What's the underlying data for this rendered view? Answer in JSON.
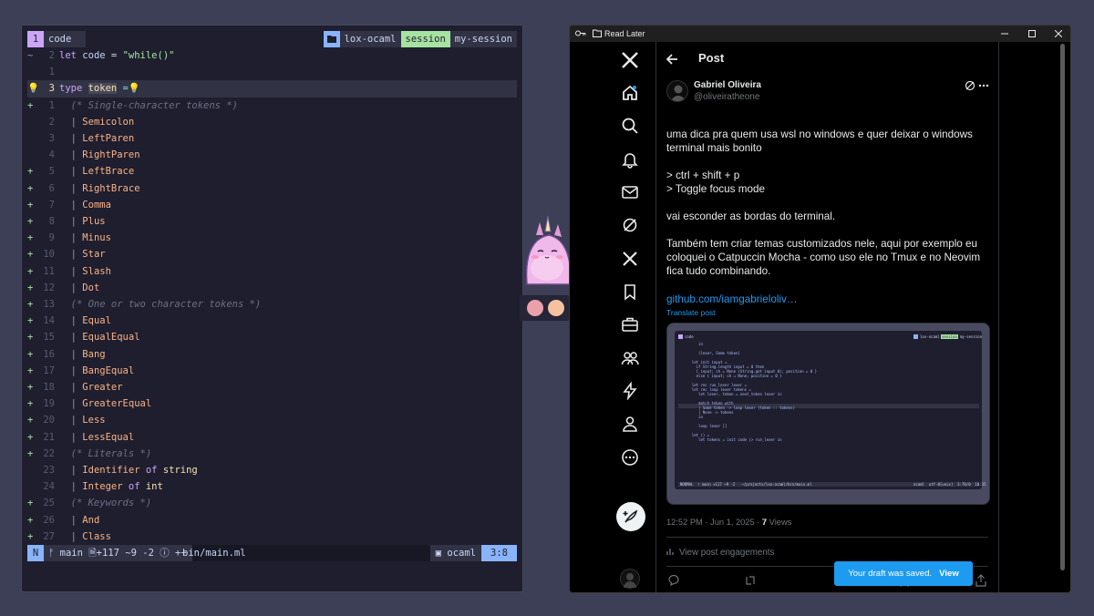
{
  "terminal": {
    "tmux": {
      "window_index": "1",
      "window_name": "code",
      "project": "lox-ocaml",
      "session_label": "session",
      "session_name": "my-session"
    },
    "lines": [
      {
        "sign": "~",
        "num": "2",
        "parts": [
          [
            "kw",
            "let "
          ],
          [
            "",
            "code = "
          ],
          [
            "str",
            "\"while()\""
          ]
        ]
      },
      {
        "sign": "",
        "num": "1",
        "parts": []
      },
      {
        "sign": "💡",
        "num": "3",
        "cur": true,
        "parts": [
          [
            "kw",
            "type "
          ],
          [
            "tok",
            "token"
          ],
          [
            "op",
            " ="
          ],
          [
            "",
            "💡"
          ]
        ]
      },
      {
        "sign": "+",
        "num": "1",
        "parts": [
          [
            "cm",
            "  (* Single-character tokens *)"
          ]
        ]
      },
      {
        "sign": "",
        "num": "2",
        "parts": [
          [
            "bar",
            "  | "
          ],
          [
            "ctor",
            "Semicolon"
          ]
        ]
      },
      {
        "sign": "",
        "num": "3",
        "parts": [
          [
            "bar",
            "  | "
          ],
          [
            "ctor",
            "LeftParen"
          ]
        ]
      },
      {
        "sign": "",
        "num": "4",
        "parts": [
          [
            "bar",
            "  | "
          ],
          [
            "ctor",
            "RightParen"
          ]
        ]
      },
      {
        "sign": "+",
        "num": "5",
        "parts": [
          [
            "bar",
            "  | "
          ],
          [
            "ctor",
            "LeftBrace"
          ]
        ]
      },
      {
        "sign": "+",
        "num": "6",
        "parts": [
          [
            "bar",
            "  | "
          ],
          [
            "ctor",
            "RightBrace"
          ]
        ]
      },
      {
        "sign": "+",
        "num": "7",
        "parts": [
          [
            "bar",
            "  | "
          ],
          [
            "ctor",
            "Comma"
          ]
        ]
      },
      {
        "sign": "+",
        "num": "8",
        "parts": [
          [
            "bar",
            "  | "
          ],
          [
            "ctor",
            "Plus"
          ]
        ]
      },
      {
        "sign": "+",
        "num": "9",
        "parts": [
          [
            "bar",
            "  | "
          ],
          [
            "ctor",
            "Minus"
          ]
        ]
      },
      {
        "sign": "+",
        "num": "10",
        "parts": [
          [
            "bar",
            "  | "
          ],
          [
            "ctor",
            "Star"
          ]
        ]
      },
      {
        "sign": "+",
        "num": "11",
        "parts": [
          [
            "bar",
            "  | "
          ],
          [
            "ctor",
            "Slash"
          ]
        ]
      },
      {
        "sign": "+",
        "num": "12",
        "parts": [
          [
            "bar",
            "  | "
          ],
          [
            "ctor",
            "Dot"
          ]
        ]
      },
      {
        "sign": "+",
        "num": "13",
        "parts": [
          [
            "cm",
            "  (* One or two character tokens *)"
          ]
        ]
      },
      {
        "sign": "+",
        "num": "14",
        "parts": [
          [
            "bar",
            "  | "
          ],
          [
            "ctor",
            "Equal"
          ]
        ]
      },
      {
        "sign": "+",
        "num": "15",
        "parts": [
          [
            "bar",
            "  | "
          ],
          [
            "ctor",
            "EqualEqual"
          ]
        ]
      },
      {
        "sign": "+",
        "num": "16",
        "parts": [
          [
            "bar",
            "  | "
          ],
          [
            "ctor",
            "Bang"
          ]
        ]
      },
      {
        "sign": "+",
        "num": "17",
        "parts": [
          [
            "bar",
            "  | "
          ],
          [
            "ctor",
            "BangEqual"
          ]
        ]
      },
      {
        "sign": "+",
        "num": "18",
        "parts": [
          [
            "bar",
            "  | "
          ],
          [
            "ctor",
            "Greater"
          ]
        ]
      },
      {
        "sign": "+",
        "num": "19",
        "parts": [
          [
            "bar",
            "  | "
          ],
          [
            "ctor",
            "GreaterEqual"
          ]
        ]
      },
      {
        "sign": "+",
        "num": "20",
        "parts": [
          [
            "bar",
            "  | "
          ],
          [
            "ctor",
            "Less"
          ]
        ]
      },
      {
        "sign": "+",
        "num": "21",
        "parts": [
          [
            "bar",
            "  | "
          ],
          [
            "ctor",
            "LessEqual"
          ]
        ]
      },
      {
        "sign": "+",
        "num": "22",
        "parts": [
          [
            "cm",
            "  (* Literals *)"
          ]
        ]
      },
      {
        "sign": "",
        "num": "23",
        "parts": [
          [
            "bar",
            "  | "
          ],
          [
            "ctor",
            "Identifier "
          ],
          [
            "kw",
            "of "
          ],
          [
            "ty",
            "string"
          ]
        ]
      },
      {
        "sign": "",
        "num": "24",
        "parts": [
          [
            "bar",
            "  | "
          ],
          [
            "ctor",
            "Integer "
          ],
          [
            "kw",
            "of "
          ],
          [
            "ty",
            "int"
          ]
        ]
      },
      {
        "sign": "+",
        "num": "25",
        "parts": [
          [
            "cm",
            "  (* Keywords *)"
          ]
        ]
      },
      {
        "sign": "+",
        "num": "26",
        "parts": [
          [
            "bar",
            "  | "
          ],
          [
            "ctor",
            "And"
          ]
        ]
      },
      {
        "sign": "+",
        "num": "27",
        "parts": [
          [
            "bar",
            "  | "
          ],
          [
            "ctor",
            "Class"
          ]
        ]
      }
    ],
    "status": {
      "mode": "N",
      "git": "ᚠ main 🗎+117 ~9 -2 ⓘ ++",
      "file": "bin/main.ml",
      "lang": "ocaml",
      "position": "3:8"
    }
  },
  "sticker": {
    "colors": {
      "dot1": "#eba0ac",
      "dot2": "#f5c2a0"
    }
  },
  "browser": {
    "title": "Read Later",
    "post_header": "Post",
    "author_name": "Gabriel Oliveira",
    "author_handle": "@oliveiratheone",
    "tweet_paragraphs": [
      "uma dica pra quem usa wsl no windows e quer deixar o windows terminal mais bonito",
      "> ctrl + shift + p",
      "> Toggle focus mode",
      "vai esconder as bordas do terminal.",
      "Também tem criar temas customizados nele, aqui por exemplo eu coloquei o Catpuccin Mocha - como uso ele no Tmux e no Neovim fica tudo combinando."
    ],
    "link": "github.com/iamgabrieloliv…",
    "translate": "Translate post",
    "time": "12:52 PM · Jun 1, 2025 · ",
    "views_count": "7",
    "views_label": " Views",
    "engagements": "View post engagements",
    "toast_text": "Your draft was saved.",
    "toast_action": "View",
    "embed": {
      "tab": "code",
      "project": "lox-ocaml",
      "session_label": "session",
      "session_name": "my-session",
      "code": "     in\n\n     (lexer, Some token)\n\n  let init input =\n    if String.length input = 0 then\n    { input; ch = None (String.get input 0); position = 0 }\n    else { input; ch = None; position = 0 }\n\n  let rec run_lexer lexer =\n  let rec loop lexer tokens =\n     let lexer, token = next_token lexer in\n\n     match token with\n     | Some token -> loop lexer (token :: tokens)\n     | None -> tokens\n     in\n\n     loop lexer []\n\n  let () =\n     let tokens = init code |> run_lexer in",
      "status_left": "NORMAL  ᚠ main +117 ~9 -2   ~/projects/lox-ocaml/bin/main.ml",
      "status_right": "ocaml  utf-8[unix]  3:78/0  10:35"
    }
  }
}
